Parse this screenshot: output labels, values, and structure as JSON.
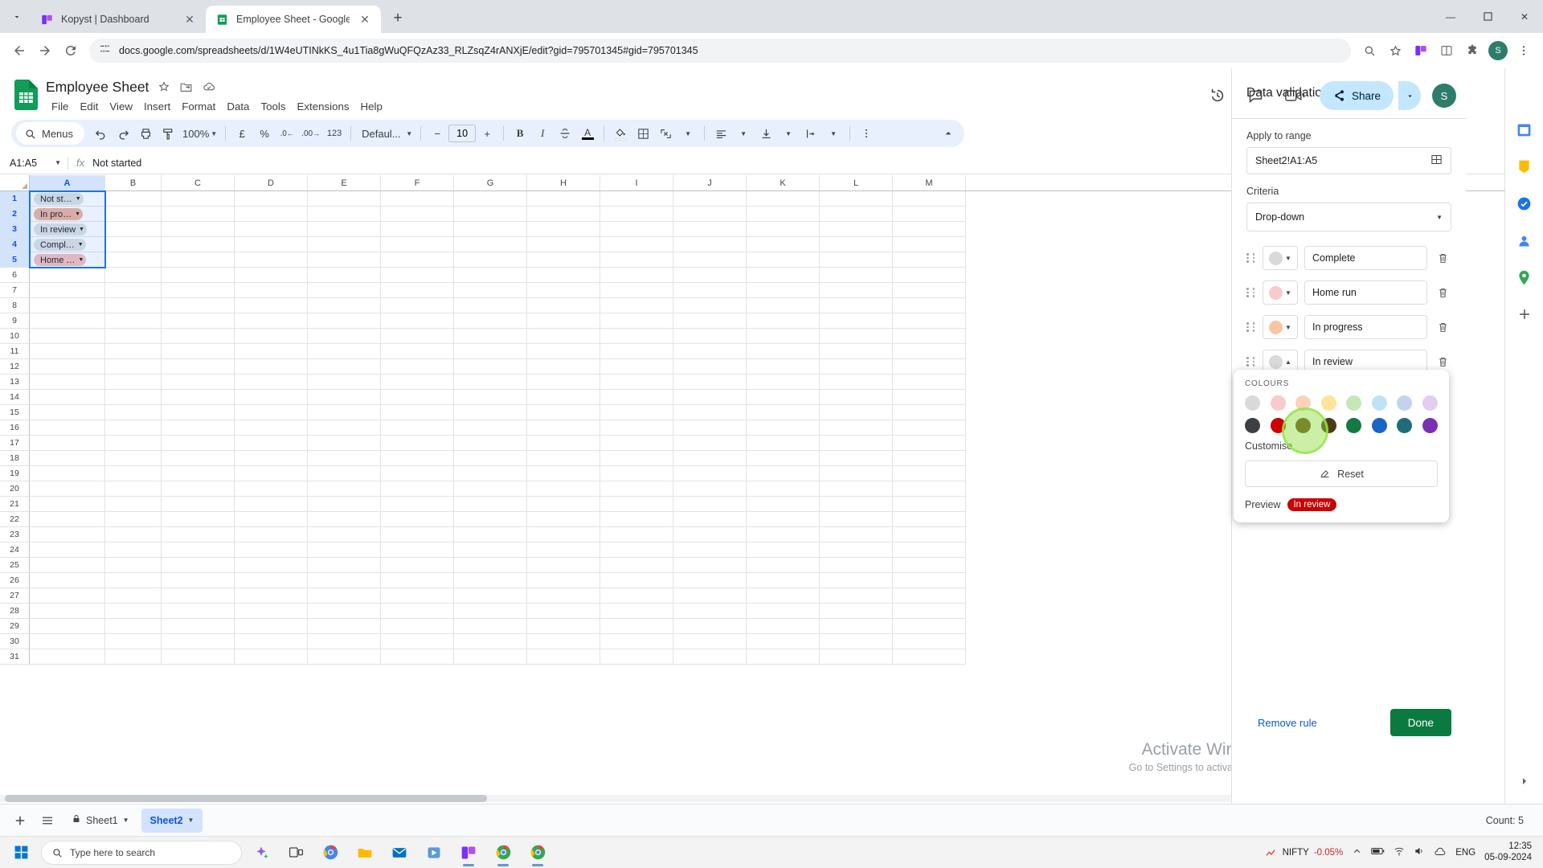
{
  "browser": {
    "tabs": [
      {
        "title": "Kopyst | Dashboard",
        "favicon": "kopyst-icon",
        "active": false
      },
      {
        "title": "Employee Sheet - Google Sheet",
        "favicon": "sheets-icon",
        "active": true
      }
    ],
    "new_tab_label": "+",
    "window_controls": {
      "minimize": "—",
      "maximize": "❐",
      "close": "✕"
    },
    "nav": {
      "back": "←",
      "forward": "→",
      "reload": "↻"
    },
    "url": "docs.google.com/spreadsheets/d/1W4eUTINkKS_4u1Tia8gWuQFQzAz33_RLZsqZ4rANXjE/edit?gid=795701345#gid=795701345",
    "profile_initial": "S"
  },
  "doc": {
    "title": "Employee Sheet",
    "menus": [
      "File",
      "Edit",
      "View",
      "Insert",
      "Format",
      "Data",
      "Tools",
      "Extensions",
      "Help"
    ],
    "header_icons": [
      "star-icon",
      "move-to-folder-icon",
      "cloud-saved-icon"
    ],
    "actions": {
      "history_icon": "version-history-icon",
      "comment_icon": "comment-icon",
      "meet_icon": "meet-icon",
      "share_label": "Share",
      "avatar_initial": "S"
    }
  },
  "toolbar": {
    "search_label": "Menus",
    "zoom": "100%",
    "currency": "£",
    "percent": "%",
    "decimal_decrease": ".0",
    "decimal_increase": ".00",
    "number_format": "123",
    "font": "Defaul...",
    "font_size": "10",
    "bold": "B",
    "italic": "I",
    "strikethrough": "S",
    "text_color": "A",
    "more": "⋮"
  },
  "formula_bar": {
    "name_box": "A1:A5",
    "fx": "fx",
    "value": "Not started"
  },
  "grid": {
    "columns": [
      "A",
      "B",
      "C",
      "D",
      "E",
      "F",
      "G",
      "H",
      "I",
      "J",
      "K",
      "L",
      "M"
    ],
    "selected_column": "A",
    "row_count": 31,
    "selected_rows": [
      1,
      2,
      3,
      4,
      5
    ],
    "cells": [
      {
        "row": 1,
        "text": "Not st…",
        "bg": "#dfe1e5"
      },
      {
        "row": 2,
        "text": "In pro…",
        "bg": "#f0b3a1"
      },
      {
        "row": 3,
        "text": "In review",
        "bg": "#dfe1e5"
      },
      {
        "row": 4,
        "text": "Compl…",
        "bg": "#dfe1e5"
      },
      {
        "row": 5,
        "text": "Home …",
        "bg": "#f7c0c0"
      }
    ]
  },
  "panel": {
    "title": "Data validation rules",
    "close_icon": "close-icon",
    "apply_to_range_label": "Apply to range",
    "apply_to_range_value": "Sheet2!A1:A5",
    "range_picker_icon": "grid-picker-icon",
    "criteria_label": "Criteria",
    "criteria_value": "Drop-down",
    "rules": [
      {
        "label": "Complete",
        "color": "#d9d9d9"
      },
      {
        "label": "Home run",
        "color": "#f7cbcb"
      },
      {
        "label": "In progress",
        "color": "#f7c7a3"
      },
      {
        "label": "In review",
        "color": "#d9d9d9"
      }
    ],
    "advanced_label": "",
    "remove_rule_label": "Remove rule",
    "done_label": "Done"
  },
  "color_popup": {
    "heading": "COLOURS",
    "row1": [
      "#d9d9d9",
      "#f7cbcb",
      "#fad3bd",
      "#fde49a",
      "#c6e8b8",
      "#bfe3f5",
      "#c3d3ef",
      "#e3cdf0"
    ],
    "row2": [
      "#3c4043",
      "#cc0000",
      "#6b4b19",
      "#4b3a1a",
      "#127a43",
      "#1a64c8",
      "#1f6d78",
      "#7b2fb5"
    ],
    "customise_label": "Customise",
    "reset_label": "Reset",
    "reset_icon": "reset-format-icon",
    "preview_label": "Preview",
    "preview_chip_text": "In review",
    "preview_chip_bg": "#cc0000",
    "preview_chip_fg": "#ffffff"
  },
  "watermark": {
    "line1": "Activate Windows",
    "line2": "Go to Settings to activate Windows."
  },
  "sheetbar": {
    "add_icon": "add-sheet-icon",
    "all_sheets_icon": "all-sheets-icon",
    "tabs": [
      {
        "label": "Sheet1",
        "locked": true,
        "active": false
      },
      {
        "label": "Sheet2",
        "locked": false,
        "active": true
      }
    ],
    "count": "Count: 5"
  },
  "rail": [
    "calendar-icon",
    "keep-icon",
    "tasks-icon",
    "contacts-icon",
    "maps-icon",
    "add-apps-icon"
  ],
  "taskbar": {
    "start_icon": "windows-start-icon",
    "search_placeholder": "Type here to search",
    "apps": [
      "copilot-icon",
      "task-view-icon",
      "chrome-icon",
      "explorer-icon",
      "mail-icon",
      "store-icon",
      "kopyst-icon",
      "chrome-icon",
      "chrome-icon"
    ],
    "nifty_label": "NIFTY",
    "nifty_change": "-0.05%",
    "language": "ENG",
    "time": "12:35",
    "date": "05-09-2024"
  }
}
